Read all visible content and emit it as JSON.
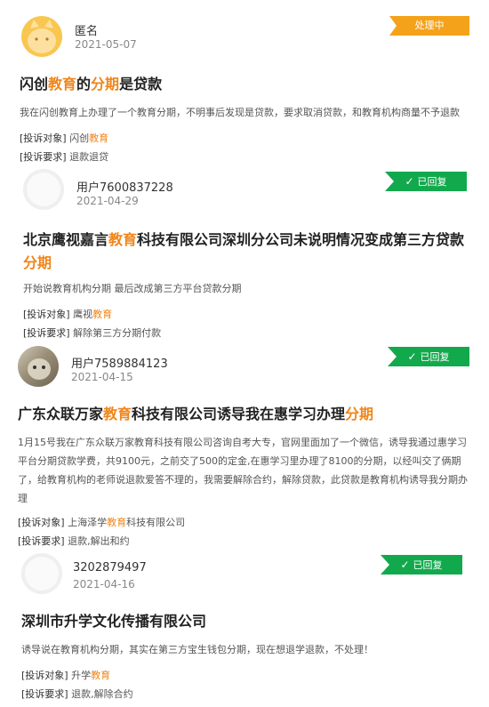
{
  "complaints": [
    {
      "user": "匿名",
      "date": "2021-05-07",
      "status": "处理中",
      "title": [
        "闪创",
        "教育",
        "的",
        "分期",
        "是贷款"
      ],
      "description": "我在闪创教育上办理了一个教育分期，不明事后发现是贷款，要求取消贷款，和教育机构商量不予退款",
      "target_label": "[投诉对象]",
      "target": [
        "闪创",
        "教育"
      ],
      "request_label": "[投诉要求]",
      "request": "退款退贷"
    },
    {
      "user": "用户7600837228",
      "date": "2021-04-29",
      "status": "已回复",
      "title": [
        "北京鹰视嘉言",
        "教育",
        "科技有限公司深圳分公司未说明情况变成第三方贷款",
        "分期",
        ""
      ],
      "description": "开始说教育机构分期 最后改成第三方平台贷款分期",
      "target_label": "[投诉对象]",
      "target": [
        "鹰视",
        "教育"
      ],
      "request_label": "[投诉要求]",
      "request": "解除第三方分期付款"
    },
    {
      "user": "用户7589884123",
      "date": "2021-04-15",
      "status": "已回复",
      "title": [
        "广东众联万家",
        "教育",
        "科技有限公司诱导我在惠学习办理",
        "分期",
        ""
      ],
      "description": "1月15号我在广东众联万家教育科技有限公司咨询自考大专，官网里面加了一个微信，诱导我通过惠学习平台分期贷款学费，共9100元，之前交了500的定金,在惠学习里办理了8100的分期，以经叫交了俩期了，给教育机构的老师说退款爱答不理的，我需要解除合约，解除贷款，此贷款是教育机构诱导我分期办理",
      "target_label": "[投诉对象]",
      "target": [
        "上海泽学",
        "教育",
        "科技有限公司"
      ],
      "request_label": "[投诉要求]",
      "request": "退款,解出和约"
    },
    {
      "user": "3202879497",
      "date": "2021-04-16",
      "status": "已回复",
      "title": [
        "深圳市升学文化传播有限公司",
        "",
        "",
        "",
        ""
      ],
      "description": "诱导说在教育机构分期，其实在第三方宝生钱包分期，现在想退学退款，不处理！",
      "target_label": "[投诉对象]",
      "target": [
        "升学",
        "教育"
      ],
      "request_label": "[投诉要求]",
      "request": "退款,解除合约"
    }
  ],
  "icons": {
    "check": "✓"
  }
}
